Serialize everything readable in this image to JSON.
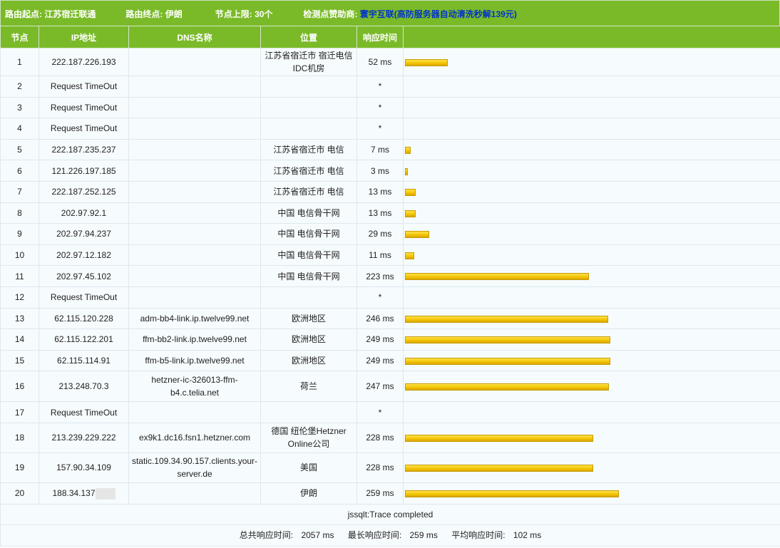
{
  "header": {
    "route_start_label": "路由起点:",
    "route_start": "江苏宿迁联通",
    "route_end_label": "路由终点:",
    "route_end": "伊朗",
    "hop_limit_label": "节点上限:",
    "hop_limit": "30个",
    "sponsor_label": "检测点赞助商:",
    "sponsor_name": "寰宇互联",
    "sponsor_ad_open": "(",
    "sponsor_ad": "高防服务器自动清洗秒解139元",
    "sponsor_ad_close": ")"
  },
  "columns": {
    "hop": "节点",
    "ip": "IP地址",
    "dns": "DNS名称",
    "location": "位置",
    "time": "响应时间",
    "bar": ""
  },
  "hops": [
    {
      "hop": "1",
      "ip": "222.187.226.193",
      "dns": "",
      "location": "江苏省宿迁市 宿迁电信IDC机房",
      "time": "52 ms",
      "ms": 52
    },
    {
      "hop": "2",
      "ip": "Request TimeOut",
      "dns": "",
      "location": "",
      "time": "*",
      "ms": 0
    },
    {
      "hop": "3",
      "ip": "Request TimeOut",
      "dns": "",
      "location": "",
      "time": "*",
      "ms": 0
    },
    {
      "hop": "4",
      "ip": "Request TimeOut",
      "dns": "",
      "location": "",
      "time": "*",
      "ms": 0
    },
    {
      "hop": "5",
      "ip": "222.187.235.237",
      "dns": "",
      "location": "江苏省宿迁市 电信",
      "time": "7 ms",
      "ms": 7
    },
    {
      "hop": "6",
      "ip": "121.226.197.185",
      "dns": "",
      "location": "江苏省宿迁市 电信",
      "time": "3 ms",
      "ms": 3
    },
    {
      "hop": "7",
      "ip": "222.187.252.125",
      "dns": "",
      "location": "江苏省宿迁市 电信",
      "time": "13 ms",
      "ms": 13
    },
    {
      "hop": "8",
      "ip": "202.97.92.1",
      "dns": "",
      "location": "中国 电信骨干网",
      "time": "13 ms",
      "ms": 13
    },
    {
      "hop": "9",
      "ip": "202.97.94.237",
      "dns": "",
      "location": "中国 电信骨干网",
      "time": "29 ms",
      "ms": 29
    },
    {
      "hop": "10",
      "ip": "202.97.12.182",
      "dns": "",
      "location": "中国 电信骨干网",
      "time": "11 ms",
      "ms": 11
    },
    {
      "hop": "11",
      "ip": "202.97.45.102",
      "dns": "",
      "location": "中国 电信骨干网",
      "time": "223 ms",
      "ms": 223
    },
    {
      "hop": "12",
      "ip": "Request TimeOut",
      "dns": "",
      "location": "",
      "time": "*",
      "ms": 0
    },
    {
      "hop": "13",
      "ip": "62.115.120.228",
      "dns": "adm-bb4-link.ip.twelve99.net",
      "location": "欧洲地区",
      "time": "246 ms",
      "ms": 246
    },
    {
      "hop": "14",
      "ip": "62.115.122.201",
      "dns": "ffm-bb2-link.ip.twelve99.net",
      "location": "欧洲地区",
      "time": "249 ms",
      "ms": 249
    },
    {
      "hop": "15",
      "ip": "62.115.114.91",
      "dns": "ffm-b5-link.ip.twelve99.net",
      "location": "欧洲地区",
      "time": "249 ms",
      "ms": 249
    },
    {
      "hop": "16",
      "ip": "213.248.70.3",
      "dns": "hetzner-ic-326013-ffm-b4.c.telia.net",
      "location": "荷兰",
      "time": "247 ms",
      "ms": 247
    },
    {
      "hop": "17",
      "ip": "Request TimeOut",
      "dns": "",
      "location": "",
      "time": "*",
      "ms": 0
    },
    {
      "hop": "18",
      "ip": "213.239.229.222",
      "dns": "ex9k1.dc16.fsn1.hetzner.com",
      "location": "德国 纽伦堡Hetzner Online公司",
      "time": "228 ms",
      "ms": 228
    },
    {
      "hop": "19",
      "ip": "157.90.34.109",
      "dns": "static.109.34.90.157.clients.your-server.de",
      "location": "美国",
      "time": "228 ms",
      "ms": 228
    },
    {
      "hop": "20",
      "ip": "188.34.137",
      "dns": "",
      "location": "伊朗",
      "time": "259 ms",
      "ms": 259,
      "masked": true
    }
  ],
  "status": "jssqlt:Trace completed",
  "summary": {
    "total_label": "总共响应时间:",
    "total_value": "2057 ms",
    "max_label": "最长响应时间:",
    "max_value": "259 ms",
    "avg_label": "平均响应时间:",
    "avg_value": "102 ms"
  },
  "colors": {
    "header_green": "#7aba28",
    "sponsor_link": "#0033cc",
    "bar_yellow": "#f2c200"
  }
}
